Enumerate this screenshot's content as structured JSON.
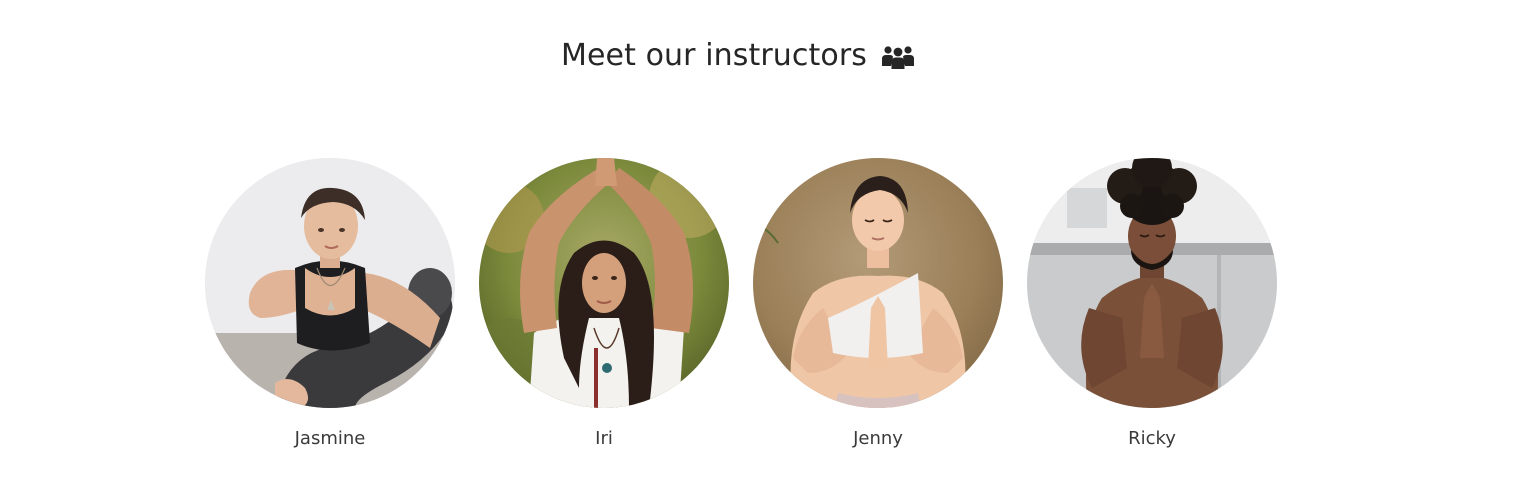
{
  "section": {
    "title": "Meet our instructors",
    "title_icon": "group-of-people-icon"
  },
  "instructors": [
    {
      "name": "Jasmine",
      "photo": "woman-yoga-pose-photo"
    },
    {
      "name": "Iri",
      "photo": "woman-arms-raised-photo"
    },
    {
      "name": "Jenny",
      "photo": "woman-prayer-hands-photo"
    },
    {
      "name": "Ricky",
      "photo": "man-prayer-hands-photo"
    }
  ],
  "colors": {
    "heading_text": "#262626",
    "name_text": "#3a3a3a",
    "background": "#ffffff"
  }
}
